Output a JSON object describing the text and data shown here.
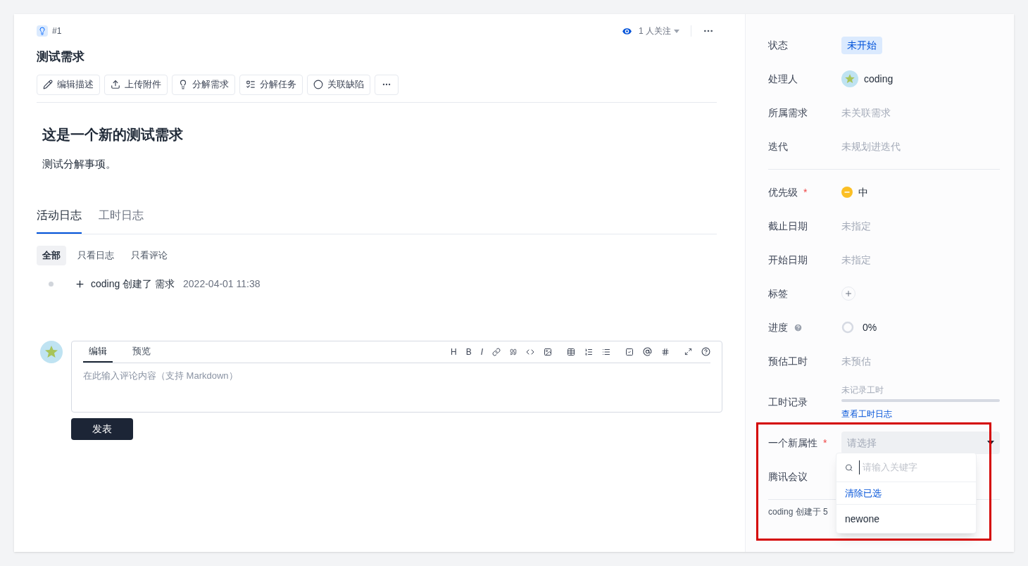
{
  "issue": {
    "number": "#1",
    "title": "测试需求",
    "watchers": "1 人关注"
  },
  "actions": [
    {
      "kind": "edit",
      "label": "编辑描述"
    },
    {
      "kind": "upload",
      "label": "上传附件"
    },
    {
      "kind": "split-requirement",
      "label": "分解需求"
    },
    {
      "kind": "split-task",
      "label": "分解任务"
    },
    {
      "kind": "link-defect",
      "label": "关联缺陷"
    }
  ],
  "description": {
    "heading": "这是一个新的测试需求",
    "body": "测试分解事项。"
  },
  "tabs": [
    {
      "label": "活动日志",
      "selected": true
    },
    {
      "label": "工时日志",
      "selected": false
    }
  ],
  "filters": [
    {
      "label": "全部",
      "selected": true
    },
    {
      "label": "只看日志",
      "selected": false
    },
    {
      "label": "只看评论",
      "selected": false
    }
  ],
  "activity": [
    {
      "text": "coding 创建了 需求",
      "time": "2022-04-01 11:38"
    }
  ],
  "editor": {
    "tabs": [
      {
        "label": "编辑",
        "selected": true
      },
      {
        "label": "预览",
        "selected": false
      }
    ],
    "format_letters": [
      "H",
      "B",
      "I"
    ],
    "placeholder": "在此输入评论内容（支持 Markdown）",
    "submit": "发表"
  },
  "sidebar": {
    "fields": [
      {
        "kind": "status",
        "label": "状态",
        "value": "未开始"
      },
      {
        "kind": "user",
        "label": "处理人",
        "value": "coding"
      },
      {
        "kind": "empty",
        "label": "所属需求",
        "value": "未关联需求"
      },
      {
        "kind": "empty",
        "label": "迭代",
        "value": "未规划进迭代"
      },
      {
        "kind": "divider"
      },
      {
        "kind": "priority",
        "label": "优先级",
        "required_mark": "*",
        "value": "中",
        "color": "#fbbf24"
      },
      {
        "kind": "empty",
        "label": "截止日期",
        "value": "未指定"
      },
      {
        "kind": "empty",
        "label": "开始日期",
        "value": "未指定"
      },
      {
        "kind": "tags",
        "label": "标签"
      },
      {
        "kind": "progress",
        "label": "进度",
        "value": "0%"
      },
      {
        "kind": "empty",
        "label": "预估工时",
        "value": "未预估"
      },
      {
        "kind": "worklog",
        "label": "工时记录",
        "value": "未记录工时",
        "level": 0,
        "link": "查看工时日志"
      },
      {
        "kind": "select",
        "label": "一个新属性",
        "required_mark": "*",
        "placeholder": "请选择",
        "open": true
      },
      {
        "kind": "empty",
        "label": "腾讯会议"
      },
      {
        "kind": "divider"
      }
    ],
    "footer": "coding 创建于 5",
    "dropdown": {
      "search_placeholder": "请输入关键字",
      "clear": "清除已选",
      "options": [
        "newone"
      ]
    }
  }
}
